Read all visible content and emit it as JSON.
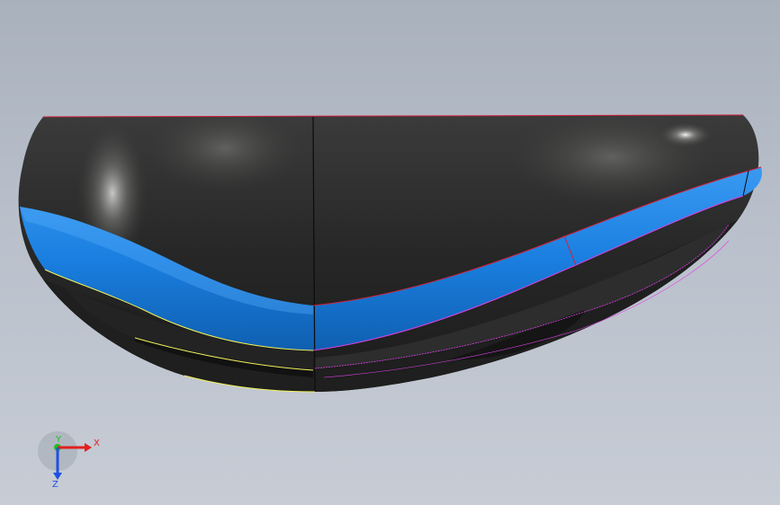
{
  "viewport": {
    "background_top": "#a9b1bd",
    "background_bottom": "#c7ccd5"
  },
  "model": {
    "body_color": "#2a2b2a",
    "band_color": "#1a7fe0",
    "edge_colors": {
      "top": "#d0203a",
      "left_lower": "#f2f25a",
      "right_lower": "#e040e8"
    }
  },
  "triad": {
    "axes": {
      "x": {
        "label": "X",
        "color": "#e02020"
      },
      "y": {
        "label": "Y",
        "color": "#20c020"
      },
      "z": {
        "label": "Z",
        "color": "#2050e0"
      }
    }
  }
}
